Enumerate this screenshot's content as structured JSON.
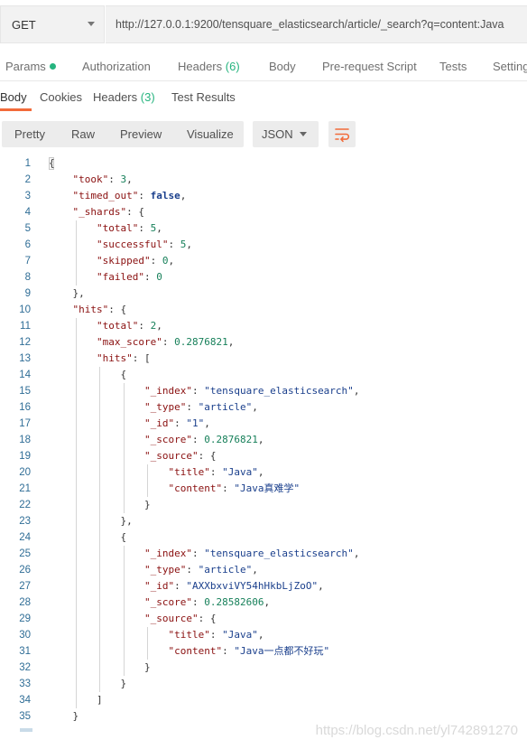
{
  "request": {
    "method": "GET",
    "url": "http://127.0.0.1:9200/tensquare_elasticsearch/article/_search?q=content:Java"
  },
  "request_tabs": [
    {
      "label": "Params",
      "has_dot": true
    },
    {
      "label": "Authorization"
    },
    {
      "label": "Headers",
      "count": "(6)"
    },
    {
      "label": "Body"
    },
    {
      "label": "Pre-request Script"
    },
    {
      "label": "Tests"
    },
    {
      "label": "Settings"
    }
  ],
  "response_tabs": [
    {
      "label": "Body",
      "active": true
    },
    {
      "label": "Cookies"
    },
    {
      "label": "Headers",
      "count": "(3)"
    },
    {
      "label": "Test Results"
    }
  ],
  "view_modes": [
    "Pretty",
    "Raw",
    "Preview",
    "Visualize"
  ],
  "format": "JSON",
  "wrap_icon": "wrap-lines-icon",
  "accent_color": "#f26b3a",
  "count_color": "#26b47f",
  "code_lines": [
    "{",
    "\"took\": 3,",
    "\"timed_out\": false,",
    "\"_shards\": {",
    "\"total\": 5,",
    "\"successful\": 5,",
    "\"skipped\": 0,",
    "\"failed\": 0",
    "},",
    "\"hits\": {",
    "\"total\": 2,",
    "\"max_score\": 0.2876821,",
    "\"hits\": [",
    "{",
    "\"_index\": \"tensquare_elasticsearch\",",
    "\"_type\": \"article\",",
    "\"_id\": \"1\",",
    "\"_score\": 0.2876821,",
    "\"_source\": {",
    "\"title\": \"Java\",",
    "\"content\": \"Java真难学\"",
    "}",
    "},",
    "{",
    "\"_index\": \"tensquare_elasticsearch\",",
    "\"_type\": \"article\",",
    "\"_id\": \"AXXbxviVY54hHkbLjZoO\",",
    "\"_score\": 0.28582606,",
    "\"_source\": {",
    "\"title\": \"Java\",",
    "\"content\": \"Java一点都不好玩\"",
    "}",
    "}",
    "]",
    "}"
  ],
  "watermark": "https://blog.csdn.net/yl742891270"
}
